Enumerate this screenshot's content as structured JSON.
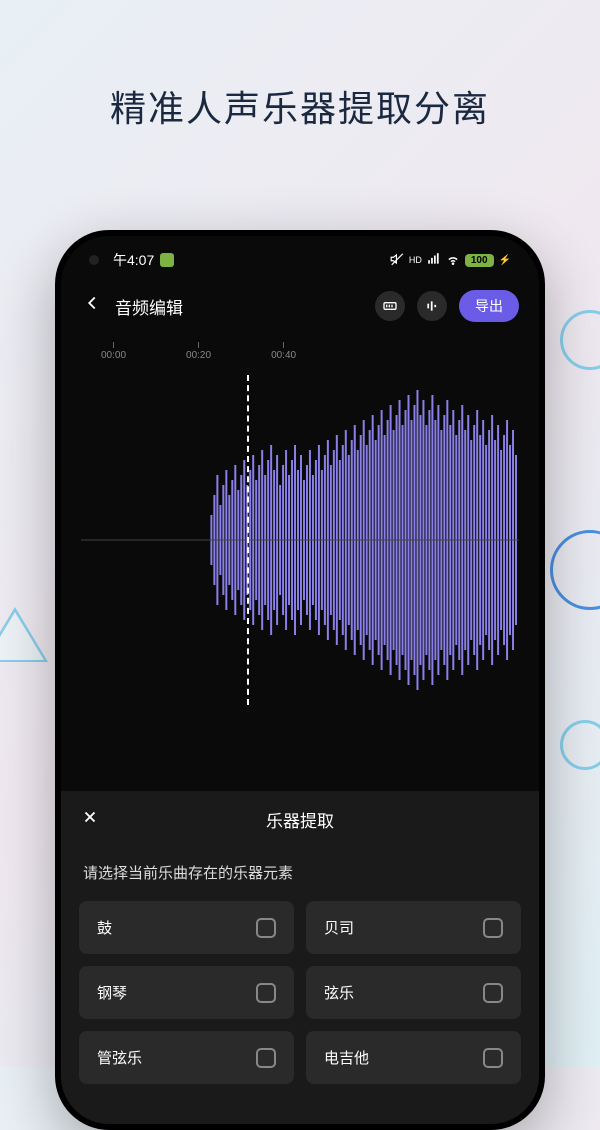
{
  "page": {
    "title": "精准人声乐器提取分离"
  },
  "status_bar": {
    "time": "午4:07",
    "battery": "100"
  },
  "header": {
    "title": "音频编辑",
    "export_label": "导出"
  },
  "timeline": {
    "ticks": [
      "00:00",
      "00:20",
      "00:40"
    ]
  },
  "sheet": {
    "title": "乐器提取",
    "subtitle": "请选择当前乐曲存在的乐器元素",
    "options": [
      {
        "label": "鼓"
      },
      {
        "label": "贝司"
      },
      {
        "label": "钢琴"
      },
      {
        "label": "弦乐"
      },
      {
        "label": "管弦乐"
      },
      {
        "label": "电吉他"
      }
    ]
  },
  "icons": {
    "back": "back-arrow-icon",
    "keyboard": "keyboard-icon",
    "equalizer": "equalizer-icon",
    "close": "close-icon",
    "mute": "mute-icon",
    "signal": "signal-icon",
    "wifi": "wifi-icon"
  }
}
